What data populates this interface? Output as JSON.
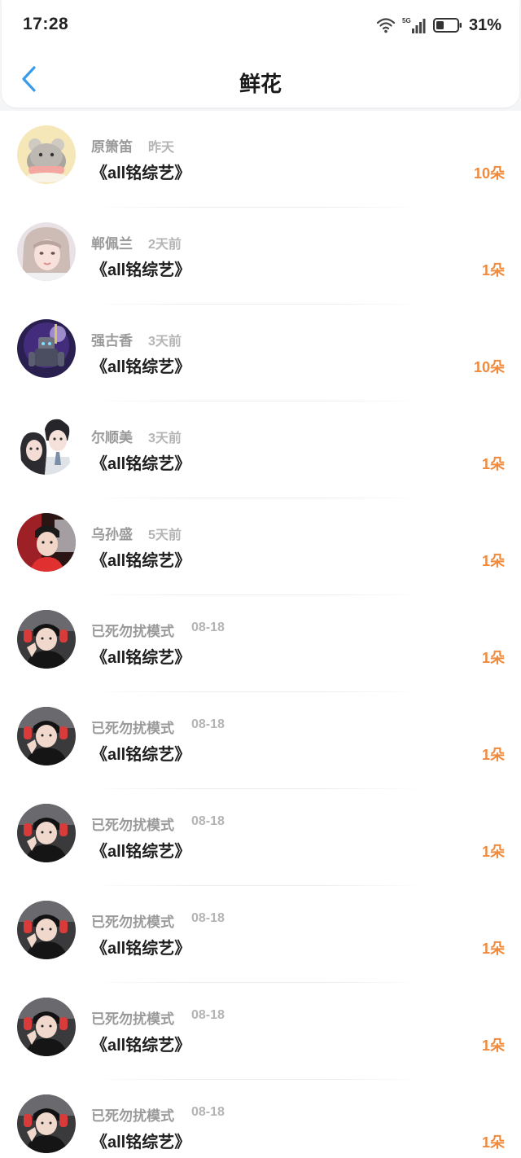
{
  "status_bar": {
    "time": "17:28",
    "network": "5G",
    "battery": "31%"
  },
  "header": {
    "title": "鲜花"
  },
  "items": [
    {
      "name": "原箫笛",
      "time": "昨天",
      "work": "《all铭综艺》",
      "count": "10朵",
      "avatar": "hamster-avatar"
    },
    {
      "name": "郸佩兰",
      "time": "2天前",
      "work": "《all铭综艺》",
      "count": "1朵",
      "avatar": "girl-avatar"
    },
    {
      "name": "强古香",
      "time": "3天前",
      "work": "《all铭综艺》",
      "count": "10朵",
      "avatar": "robot-avatar"
    },
    {
      "name": "尔顺美",
      "time": "3天前",
      "work": "《all铭综艺》",
      "count": "1朵",
      "avatar": "couple-avatar"
    },
    {
      "name": "乌孙盛",
      "time": "5天前",
      "work": "《all铭综艺》",
      "count": "1朵",
      "avatar": "boy-avatar"
    },
    {
      "name": "已死勿扰模式",
      "time": "08-18",
      "work": "《all铭综艺》",
      "count": "1朵",
      "avatar": "selfie-avatar"
    },
    {
      "name": "已死勿扰模式",
      "time": "08-18",
      "work": "《all铭综艺》",
      "count": "1朵",
      "avatar": "selfie-avatar"
    },
    {
      "name": "已死勿扰模式",
      "time": "08-18",
      "work": "《all铭综艺》",
      "count": "1朵",
      "avatar": "selfie-avatar"
    },
    {
      "name": "已死勿扰模式",
      "time": "08-18",
      "work": "《all铭综艺》",
      "count": "1朵",
      "avatar": "selfie-avatar"
    },
    {
      "name": "已死勿扰模式",
      "time": "08-18",
      "work": "《all铭综艺》",
      "count": "1朵",
      "avatar": "selfie-avatar"
    },
    {
      "name": "已死勿扰模式",
      "time": "08-18",
      "work": "《all铭综艺》",
      "count": "1朵",
      "avatar": "selfie-avatar"
    }
  ],
  "colors": {
    "accent": "#f08a3d",
    "back_arrow": "#3a9be8"
  }
}
